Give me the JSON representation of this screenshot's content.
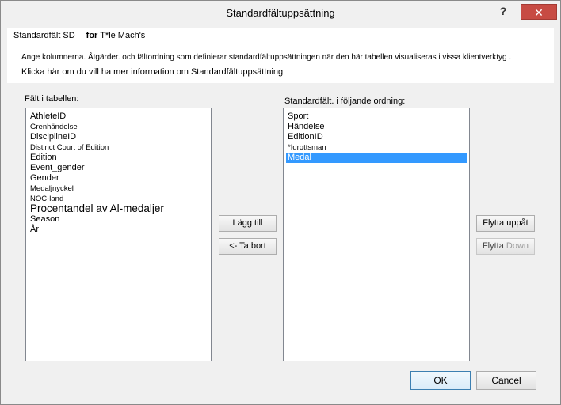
{
  "window": {
    "title": "Standardfältuppsättning",
    "help_glyph": "?",
    "close_glyph": "✕"
  },
  "info": {
    "field_set_label": "Standardfält SD",
    "for_label": "for",
    "table_name": "T*le Mach's",
    "description": "Ange kolumnerna. Åtgärder. och fältordning som definierar standardfältuppsättningen när den här tabellen visualiseras i vissa klientverktyg .",
    "help_link": "Klicka här om du vill ha mer information om Standardfältuppsättning"
  },
  "left_list": {
    "label": "Fält i tabellen:",
    "items": [
      {
        "text": "AthleteID",
        "style": "normal"
      },
      {
        "text": "Grenhändelse",
        "style": "small"
      },
      {
        "text": "DisciplineID",
        "style": "normal"
      },
      {
        "text": "Distinct Court of Edition",
        "style": "small"
      },
      {
        "text": "Edition",
        "style": "normal"
      },
      {
        "text": "Event_gender",
        "style": "normal"
      },
      {
        "text": "Gender",
        "style": "normal"
      },
      {
        "text": "Medaljnyckel",
        "style": "small"
      },
      {
        "text": "NOC-land",
        "style": "small"
      },
      {
        "text": "Procentandel av Al-medaljer",
        "style": "large"
      },
      {
        "text": "Season",
        "style": "normal"
      },
      {
        "text": "År",
        "style": "normal"
      }
    ]
  },
  "right_list": {
    "label": "Standardfält. i följande ordning:",
    "items": [
      {
        "text": "Sport",
        "style": "normal",
        "selected": false
      },
      {
        "text": "Händelse",
        "style": "normal",
        "selected": false
      },
      {
        "text": "EditionID",
        "style": "normal",
        "selected": false
      },
      {
        "text": "*Idrottsman",
        "style": "small",
        "selected": false
      },
      {
        "text": "Medal",
        "style": "normal",
        "selected": true
      }
    ]
  },
  "buttons": {
    "add": "Lägg till",
    "remove": "<- Ta bort",
    "move_up": "Flytta uppåt",
    "move_down_part1": "Flytta",
    "move_down_part2": "Down",
    "ok": "OK",
    "cancel": "Cancel"
  },
  "colors": {
    "selection": "#3399ff",
    "close_button": "#c74b43",
    "dialog_background": "#f0f0f0"
  }
}
